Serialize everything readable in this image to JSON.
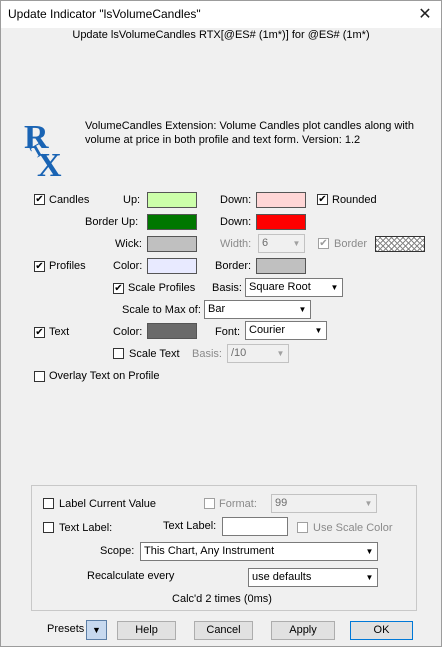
{
  "window": {
    "title": "Update Indicator \"lsVolumeCandles\"",
    "close_glyph": "✕",
    "subtitle": "Update lsVolumeCandles RTX[@ES# (1m*)] for @ES# (1m*)"
  },
  "description": "VolumeCandles Extension: Volume Candles plot candles along with volume at price in both profile and text form. Version: 1.2",
  "logo_text": "RTX",
  "candles": {
    "label": "Candles",
    "checked": "✔",
    "up_label": "Up:",
    "up_color": "#ccffaa",
    "down_label": "Down:",
    "down_color": "#ffd6d6",
    "rounded_label": "Rounded",
    "rounded_checked": "✔",
    "border_up_label": "Border  Up:",
    "border_up_color": "#007700",
    "border_down_label": "Down:",
    "border_down_color": "#ff0000",
    "wick_label": "Wick:",
    "wick_color": "#c0c0c0",
    "width_label": "Width:",
    "width_value": "6",
    "border_label": "Border",
    "border_checked": "✔"
  },
  "profiles": {
    "label": "Profiles",
    "checked": "✔",
    "color_label": "Color:",
    "color": "#e8eaff",
    "border_label": "Border:",
    "border_color": "#c0c0c0",
    "scale_profiles_label": "Scale Profiles",
    "scale_profiles_checked": "✔",
    "basis_label": "Basis:",
    "basis_value": "Square Root",
    "scale_to_max_label": "Scale to Max of:",
    "scale_to_max_value": "Bar"
  },
  "text": {
    "label": "Text",
    "checked": "✔",
    "color_label": "Color:",
    "color": "#6a6a6a",
    "font_label": "Font:",
    "font_value": "Courier",
    "scale_text_label": "Scale Text",
    "basis_label": "Basis:",
    "basis_value": "/10"
  },
  "overlay_label": "Overlay Text on Profile",
  "panel": {
    "label_current_value": "Label Current Value",
    "format_label": "Format:",
    "format_value": "99",
    "text_label_check": "Text Label:",
    "text_label_field_label": "Text Label:",
    "text_label_value": "",
    "use_scale_color": "Use Scale Color",
    "scope_label": "Scope:",
    "scope_value": "This Chart, Any Instrument",
    "recalc_label": "Recalculate every",
    "recalc_value": "use defaults",
    "calc_status": "Calc'd 2 times (0ms)"
  },
  "footer": {
    "presets_label": "Presets",
    "help": "Help",
    "cancel": "Cancel",
    "apply": "Apply",
    "ok": "OK"
  },
  "icons": {
    "check": "checkmark-icon",
    "dropdown": "chevron-down-icon",
    "close": "close-icon"
  },
  "colors": {
    "logo_blue": "#1a64b4",
    "default_button_border": "#0078d7"
  }
}
